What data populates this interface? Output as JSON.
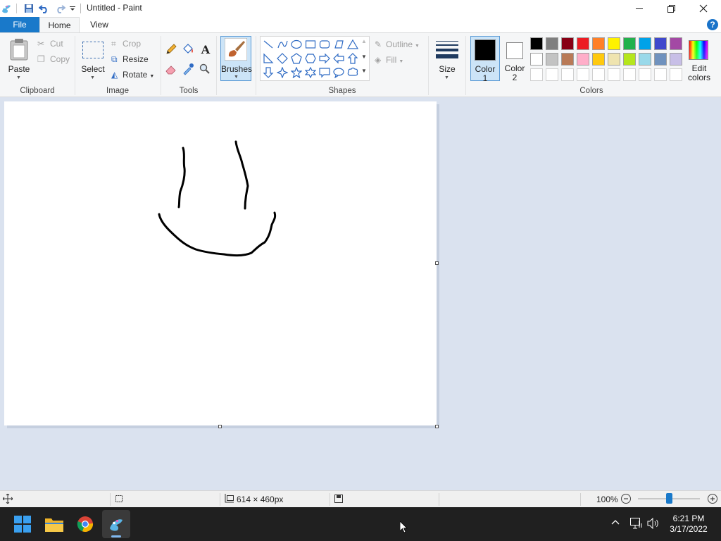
{
  "window": {
    "title": "Untitled - Paint"
  },
  "tabs": {
    "file": "File",
    "home": "Home",
    "view": "View"
  },
  "help": "?",
  "clipboard": {
    "paste": "Paste",
    "cut": "Cut",
    "copy": "Copy",
    "label": "Clipboard"
  },
  "image": {
    "select": "Select",
    "crop": "Crop",
    "resize": "Resize",
    "rotate": "Rotate",
    "label": "Image"
  },
  "tools": {
    "label": "Tools"
  },
  "brushes": {
    "label": "Brushes"
  },
  "shapes": {
    "outline": "Outline",
    "fill": "Fill",
    "label": "Shapes"
  },
  "size": {
    "label": "Size"
  },
  "colors": {
    "color1_line1": "Color",
    "color1_line2": "1",
    "color2_line1": "Color",
    "color2_line2": "2",
    "edit_line1": "Edit",
    "edit_line2": "colors",
    "label": "Colors",
    "color1": "#000000",
    "color2": "#ffffff",
    "palette_row1": [
      "#000000",
      "#7f7f7f",
      "#880015",
      "#ed1c24",
      "#ff7f27",
      "#fff200",
      "#22b14c",
      "#00a2e8",
      "#3f48cc",
      "#a349a4"
    ],
    "palette_row2": [
      "#ffffff",
      "#c3c3c3",
      "#b97a57",
      "#ffaec9",
      "#ffc90e",
      "#efe4b0",
      "#b5e61d",
      "#99d9ea",
      "#7092be",
      "#c8bfe7"
    ],
    "palette_row3": [
      "#ffffff",
      "#ffffff",
      "#ffffff",
      "#ffffff",
      "#ffffff",
      "#ffffff",
      "#ffffff",
      "#ffffff",
      "#ffffff",
      "#ffffff"
    ]
  },
  "status": {
    "dimensions": "614 × 460px",
    "zoom": "100%",
    "zoom_percent": 100
  },
  "taskbar": {
    "time": "6:21 PM",
    "date": "3/17/2022"
  }
}
